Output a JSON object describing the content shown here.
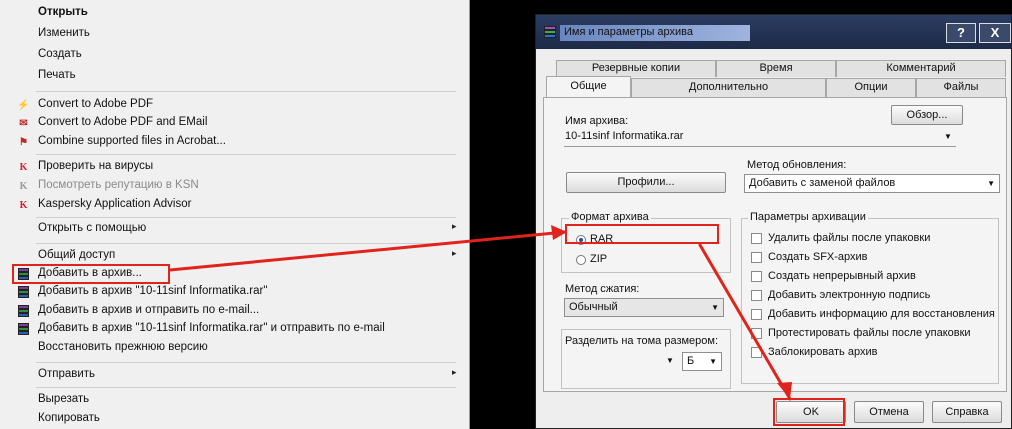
{
  "context_menu": {
    "items": [
      {
        "label": "Открыть",
        "bold": true
      },
      {
        "label": "Изменить"
      },
      {
        "label": "Создать"
      },
      {
        "label": "Печать"
      },
      {
        "label": "Convert to Adobe PDF",
        "icon": "adobe-pdf-icon"
      },
      {
        "label": "Convert to Adobe PDF and EMail",
        "icon": "adobe-pdf-email-icon"
      },
      {
        "label": "Combine supported files in Acrobat...",
        "icon": "acrobat-combine-icon"
      },
      {
        "label": "Проверить на вирусы",
        "icon": "kaspersky-icon"
      },
      {
        "label": "Посмотреть репутацию в KSN",
        "icon": "kaspersky-icon",
        "disabled": true
      },
      {
        "label": "Kaspersky Application Advisor",
        "icon": "kaspersky-icon"
      },
      {
        "label": "Открыть с помощью",
        "submenu": true
      },
      {
        "label": "Общий доступ",
        "submenu": true
      },
      {
        "label": "Добавить в архив...",
        "icon": "winrar-icon"
      },
      {
        "label": "Добавить в архив \"10-11sinf Informatika.rar\"",
        "icon": "winrar-icon"
      },
      {
        "label": "Добавить в архив и отправить по e-mail...",
        "icon": "winrar-icon"
      },
      {
        "label": "Добавить в архив \"10-11sinf Informatika.rar\" и отправить по e-mail",
        "icon": "winrar-icon"
      },
      {
        "label": "Восстановить прежнюю версию"
      },
      {
        "label": "Отправить",
        "submenu": true
      },
      {
        "label": "Вырезать"
      },
      {
        "label": "Копировать"
      }
    ],
    "submenu_glyph": "▸"
  },
  "dialog": {
    "title": "Имя и параметры архива",
    "help_label": "?",
    "close_label": "X",
    "tabs_back": [
      "Резервные копии",
      "Время",
      "Комментарий"
    ],
    "tabs_front": [
      "Общие",
      "Дополнительно",
      "Опции",
      "Файлы"
    ],
    "archive_name_label": "Имя архива:",
    "archive_name_value": "10-11sinf Informatika.rar",
    "browse_label": "Обзор...",
    "update_method_label": "Метод обновления:",
    "update_method_value": "Добавить с заменой файлов",
    "profiles_label": "Профили...",
    "format_label": "Формат архива",
    "formats": [
      {
        "label": "RAR",
        "selected": true
      },
      {
        "label": "ZIP",
        "selected": false
      }
    ],
    "compression_label": "Метод сжатия:",
    "compression_value": "Обычный",
    "split_label": "Разделить на тома размером:",
    "split_unit": "Б",
    "options_label": "Параметры архивации",
    "options": [
      {
        "label": "Удалить файлы после упаковки",
        "checked": false
      },
      {
        "label": "Создать SFX-архив",
        "checked": false
      },
      {
        "label": "Создать непрерывный архив",
        "checked": false
      },
      {
        "label": "Добавить электронную подпись",
        "checked": false
      },
      {
        "label": "Добавить информацию для восстановления",
        "checked": false
      },
      {
        "label": "Протестировать файлы после упаковки",
        "checked": false
      },
      {
        "label": "Заблокировать архив",
        "checked": false
      }
    ],
    "ok_label": "OK",
    "cancel_label": "Отмена",
    "help_button_label": "Справка"
  },
  "annotation_color": "#e0231b",
  "dropdown_glyph": "▼"
}
